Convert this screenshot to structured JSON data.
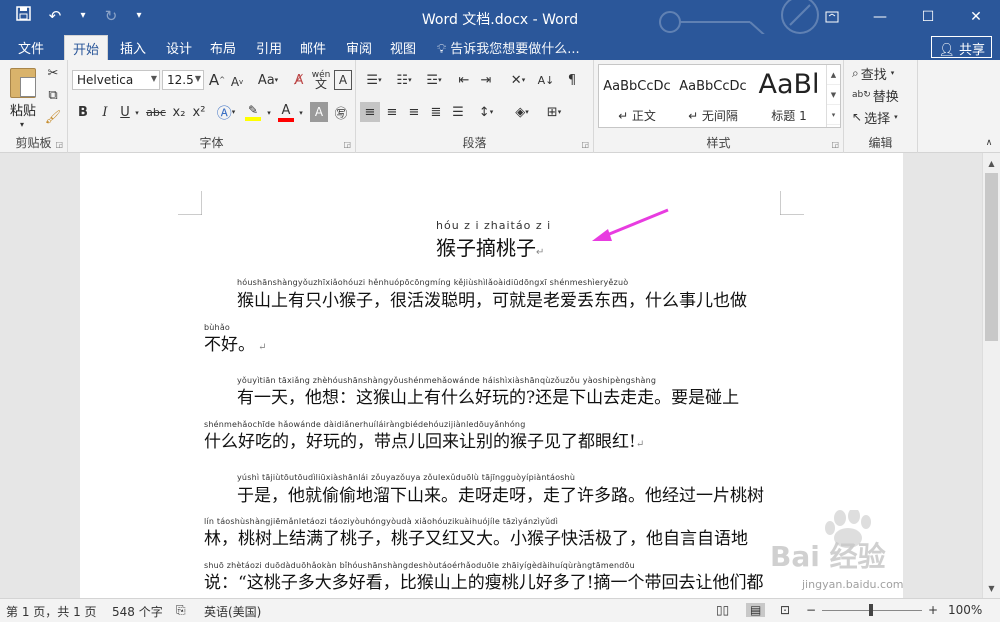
{
  "window": {
    "title": "Word 文档.docx - Word",
    "controls": [
      "ribbon-display-icon",
      "minimize-icon",
      "maximize-icon",
      "close-icon"
    ]
  },
  "tabs": {
    "file": "文件",
    "home": "开始",
    "insert": "插入",
    "design": "设计",
    "layout": "布局",
    "references": "引用",
    "mailings": "邮件",
    "review": "审阅",
    "view": "视图",
    "tellme": "告诉我您想要做什么...",
    "share": "共享"
  },
  "ribbon": {
    "clipboard": {
      "label": "剪贴板",
      "paste": "粘贴"
    },
    "font": {
      "label": "字体",
      "font_name": "Helvetica",
      "font_size": "12.5",
      "change_case": "Aa",
      "clear_format": "A",
      "bold": "B",
      "italic": "I",
      "underline": "U",
      "strike": "abc",
      "sub": "x₂",
      "sup": "x²",
      "grow": "A",
      "shrink": "A",
      "wen": "wén",
      "highlight_color": "#ffff00",
      "font_color": "#ff0000"
    },
    "paragraph": {
      "label": "段落"
    },
    "styles": {
      "label": "样式",
      "items": [
        {
          "sample": "AaBbCcDc",
          "name": "↵ 正文"
        },
        {
          "sample": "AaBbCcDc",
          "name": "↵ 无间隔"
        },
        {
          "sample": "AaBl",
          "name": "标题 1"
        }
      ]
    },
    "editing": {
      "label": "编辑",
      "find": "查找",
      "replace": "替换",
      "select": "选择"
    }
  },
  "document": {
    "title_pinyin": "hóu z i zhaitáo z i",
    "title": "猴子摘桃子",
    "lines": [
      {
        "pinyin": "hóushānshàngyǒuzhīxiǎohóuzi   hěnhuópōcōngmíng   kějiùshìlǎoàidiūdōngxī   shénmeshìeryězuò",
        "text": "猴山上有只小猴子，很活泼聪明，可就是老爱丢东西，什么事儿也做",
        "indent": true
      },
      {
        "pinyin": "bùhǎo",
        "text": "不好。",
        "indent": false,
        "mark": true
      },
      {
        "pinyin": "yǒuyìtiān   tāxiǎng   zhèhóushānshàngyǒushénmehǎowánde   háishìxiàshānqùzǒuzǒu   yàoshipèngshàng",
        "text": "有一天，他想：这猴山上有什么好玩的?还是下山去走走。要是碰上",
        "indent": true
      },
      {
        "pinyin": "shénmehǎochīde   hǎowánde   dàidiǎnerhuíláiràngbiédehóuzijiànledōuyǎnhóng",
        "text": "什么好吃的，好玩的，带点儿回来让别的猴子见了都眼红!",
        "indent": false,
        "mark": true
      },
      {
        "pinyin": "yúshì   tājiùtōutōudìliūxiàshānlái   zǒuyazǒuya   zǒulexǔduōlù   tājīngguòyípiàntáoshù",
        "text": "于是，他就偷偷地溜下山来。走呀走呀，走了许多路。他经过一片桃树",
        "indent": true
      },
      {
        "pinyin": "lín   táoshùshàngjiēmǎnletáozi   táoziyòuhóngyòudà   xiǎohóuzikuàihuójíle   tāzìyánzìyǔdì",
        "text": "林，桃树上结满了桃子，桃子又红又大。小猴子快活极了，他自言自语地",
        "indent": false
      },
      {
        "pinyin": "shuō   zhètáozi duōdàduōhǎokàn   bǐhóushānshàngdeshòutáoérhǎoduōle   zhāiyígèdàihuíqùràngtāmendōu",
        "text": "说：“这桃子多大多好看，比猴山上的瘦桃儿好多了!摘一个带回去让他们都",
        "indent": false
      }
    ]
  },
  "watermark": {
    "brand": "Bai  经验",
    "url": "jingyan.baidu.com"
  },
  "status": {
    "page": "第 1 页，共 1 页",
    "words": "548 个字",
    "language": "英语(美国)",
    "zoom": "100%",
    "zoom_minus": "−",
    "zoom_plus": "+"
  }
}
